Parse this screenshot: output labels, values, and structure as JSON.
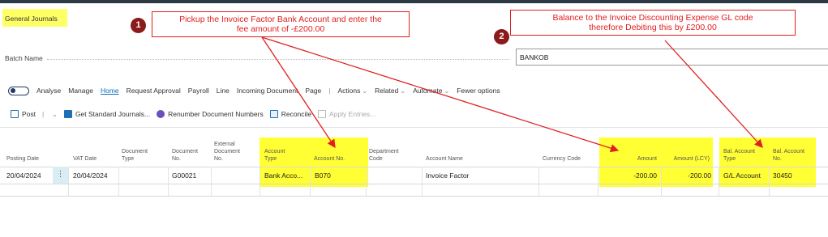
{
  "page": {
    "title": "General Journals"
  },
  "batch": {
    "label": "Batch Name",
    "value": "BANKOB"
  },
  "actionbar": {
    "analyse": "Analyse",
    "manage": "Manage",
    "home": "Home",
    "request_approval": "Request Approval",
    "payroll": "Payroll",
    "line": "Line",
    "incoming_document": "Incoming Document",
    "page": "Page",
    "actions": "Actions",
    "related": "Related",
    "automate": "Automate",
    "fewer_options": "Fewer options"
  },
  "toolbar": {
    "post": "Post",
    "get_standard_journals": "Get Standard Journals...",
    "renumber": "Renumber Document Numbers",
    "reconcile": "Reconcile",
    "apply_entries": "Apply Entries..."
  },
  "columns": {
    "posting_date": "Posting Date",
    "vat_date": "VAT Date",
    "document_type_1": "Document",
    "document_type_2": "Type",
    "document_no_1": "Document",
    "document_no_2": "No.",
    "external_1": "External",
    "external_2": "Document",
    "external_3": "No.",
    "account_type_1": "Account",
    "account_type_2": "Type",
    "account_no": "Account No.",
    "department_1": "Department",
    "department_2": "Code",
    "account_name": "Account Name",
    "currency_code": "Currency Code",
    "amount": "Amount",
    "amount_lcy": "Amount (LCY)",
    "bal_account_type_1": "Bal. Account",
    "bal_account_type_2": "Type",
    "bal_account_no_1": "Bal. Account",
    "bal_account_no_2": "No."
  },
  "row": {
    "posting_date": "20/04/2024",
    "vat_date": "20/04/2024",
    "document_no": "G00021",
    "account_type": "Bank Acco...",
    "account_no": "B070",
    "account_name": "Invoice Factor",
    "amount": "-200.00",
    "amount_lcy": "-200.00",
    "bal_account_type": "G/L Account",
    "bal_account_no": "30450"
  },
  "annotations": {
    "badge1": "1",
    "callout1_line1": "Pickup the Invoice Factor Bank Account and enter the",
    "callout1_line2": "fee amount of -£200.00",
    "badge2": "2",
    "callout2_line1": "Balance to the Invoice Discounting Expense GL code",
    "callout2_line2": "therefore Debiting this by £200.00",
    "color": "#e02020",
    "highlight": "#ffff33"
  }
}
